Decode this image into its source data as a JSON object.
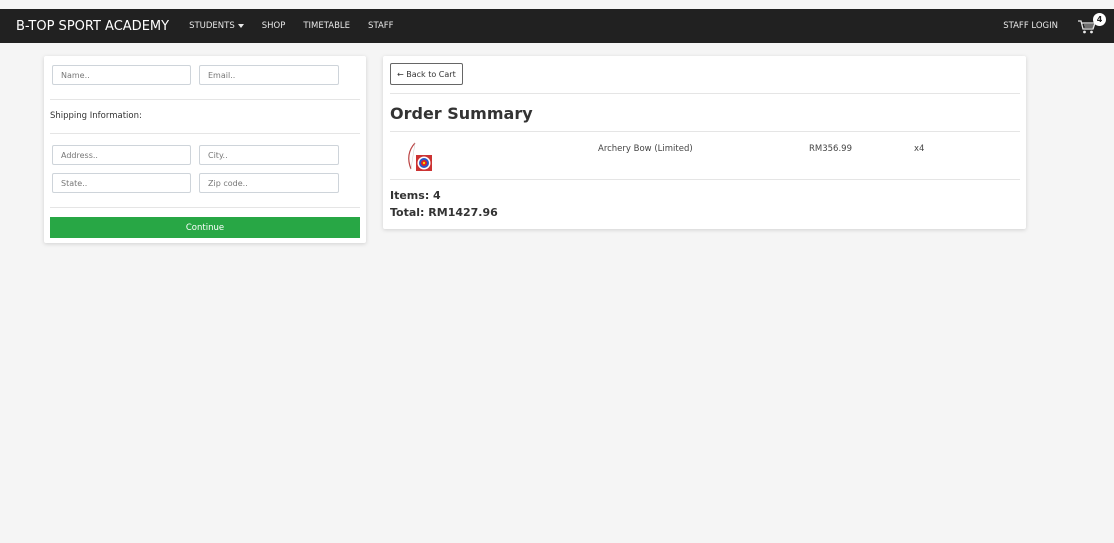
{
  "nav": {
    "brand": "B-TOP SPORT ACADEMY",
    "items": [
      {
        "label": "STUDENTS",
        "has_dropdown": true
      },
      {
        "label": "SHOP",
        "has_dropdown": false
      },
      {
        "label": "TIMETABLE",
        "has_dropdown": false
      },
      {
        "label": "STAFF",
        "has_dropdown": false
      }
    ],
    "staff_login": "STAFF LOGIN",
    "cart_count": "4",
    "cart_icon": "shopping-cart-icon"
  },
  "form": {
    "name_placeholder": "Name..",
    "email_placeholder": "Email..",
    "shipping_label": "Shipping Information:",
    "address_placeholder": "Address..",
    "city_placeholder": "City..",
    "state_placeholder": "State..",
    "zip_placeholder": "Zip code..",
    "continue_label": "Continue"
  },
  "summary": {
    "back_label": "← Back to Cart",
    "title": "Order Summary",
    "items": [
      {
        "name": "Archery Bow (Limited)",
        "price": "RM356.99",
        "qty": "x4",
        "image_icon": "archery-bow-target-icon"
      }
    ],
    "items_count": "Items: 4",
    "total": "Total: RM1427.96"
  },
  "colors": {
    "navbar": "#212121",
    "continue_button": "#28a745",
    "background": "#f5f5f5"
  }
}
